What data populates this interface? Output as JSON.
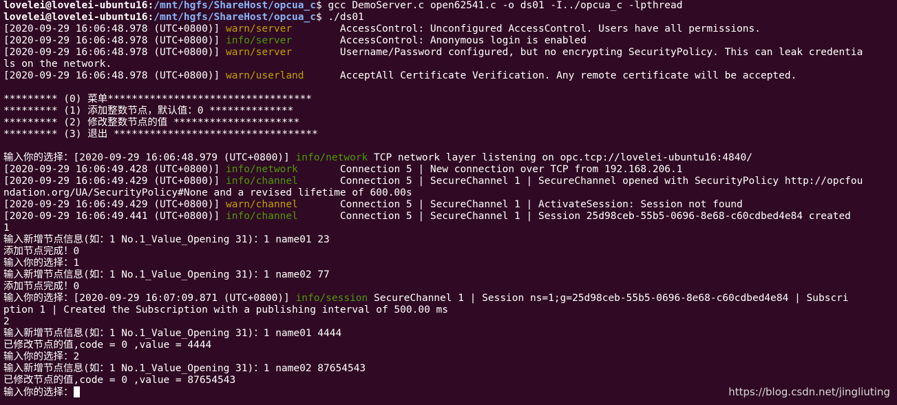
{
  "terminal": {
    "lines": [
      {
        "segments": [
          {
            "t": "lovelei@lovelei-ubuntu16",
            "c": "user"
          },
          {
            "t": ":",
            "c": "user"
          },
          {
            "t": "/mnt/hgfs/ShareHost/opcua_c",
            "c": "path"
          },
          {
            "t": "$ gcc DemoServer.c open62541.c -o ds01 -I../opcua_c -lpthread",
            "c": "plain"
          }
        ]
      },
      {
        "segments": [
          {
            "t": "lovelei@lovelei-ubuntu16",
            "c": "user"
          },
          {
            "t": ":",
            "c": "user"
          },
          {
            "t": "/mnt/hgfs/ShareHost/opcua_c",
            "c": "path"
          },
          {
            "t": "$ ./ds01",
            "c": "plain"
          }
        ]
      },
      {
        "segments": [
          {
            "t": "[2020-09-29 16:06:48.978 (UTC+0800)] ",
            "c": "plain"
          },
          {
            "t": "warn/server",
            "c": "warn"
          },
          {
            "t": "        AccessControl: Unconfigured AccessControl. Users have all permissions.",
            "c": "plain"
          }
        ]
      },
      {
        "segments": [
          {
            "t": "[2020-09-29 16:06:48.978 (UTC+0800)] ",
            "c": "plain"
          },
          {
            "t": "info/server",
            "c": "info"
          },
          {
            "t": "        AccessControl: Anonymous login is enabled",
            "c": "plain"
          }
        ]
      },
      {
        "segments": [
          {
            "t": "[2020-09-29 16:06:48.978 (UTC+0800)] ",
            "c": "plain"
          },
          {
            "t": "warn/server",
            "c": "warn"
          },
          {
            "t": "        Username/Password configured, but no encrypting SecurityPolicy. This can leak credentia",
            "c": "plain"
          }
        ]
      },
      {
        "segments": [
          {
            "t": "ls on the network.",
            "c": "plain"
          }
        ]
      },
      {
        "segments": [
          {
            "t": "[2020-09-29 16:06:48.978 (UTC+0800)] ",
            "c": "plain"
          },
          {
            "t": "warn/userland",
            "c": "warn"
          },
          {
            "t": "      AcceptAll Certificate Verification. Any remote certificate will be accepted.",
            "c": "plain"
          }
        ]
      },
      {
        "segments": [
          {
            "t": "",
            "c": "plain"
          }
        ]
      },
      {
        "segments": [
          {
            "t": "********* (0) 菜单**********************************",
            "c": "plain"
          }
        ]
      },
      {
        "segments": [
          {
            "t": "********* (1) 添加整数节点，默认值：0 **************",
            "c": "plain"
          }
        ]
      },
      {
        "segments": [
          {
            "t": "********* (2) 修改整数节点的值 *********************",
            "c": "plain"
          }
        ]
      },
      {
        "segments": [
          {
            "t": "********* (3) 退出 **********************************",
            "c": "plain"
          }
        ]
      },
      {
        "segments": [
          {
            "t": "",
            "c": "plain"
          }
        ]
      },
      {
        "segments": [
          {
            "t": "输入你的选择：[2020-09-29 16:06:48.979 (UTC+0800)] ",
            "c": "plain"
          },
          {
            "t": "info/network",
            "c": "info"
          },
          {
            "t": " TCP network layer listening on opc.tcp://lovelei-ubuntu16:4840/",
            "c": "plain"
          }
        ]
      },
      {
        "segments": [
          {
            "t": "[2020-09-29 16:06:49.428 (UTC+0800)] ",
            "c": "plain"
          },
          {
            "t": "info/network",
            "c": "info"
          },
          {
            "t": "       Connection 5 | New connection over TCP from 192.168.206.1",
            "c": "plain"
          }
        ]
      },
      {
        "segments": [
          {
            "t": "[2020-09-29 16:06:49.429 (UTC+0800)] ",
            "c": "plain"
          },
          {
            "t": "info/channel",
            "c": "info"
          },
          {
            "t": "       Connection 5 | SecureChannel 1 | SecureChannel opened with SecurityPolicy http://opcfou",
            "c": "plain"
          }
        ]
      },
      {
        "segments": [
          {
            "t": "ndation.org/UA/SecurityPolicy#None and a revised lifetime of 600.00s",
            "c": "plain"
          }
        ]
      },
      {
        "segments": [
          {
            "t": "[2020-09-29 16:06:49.429 (UTC+0800)] ",
            "c": "plain"
          },
          {
            "t": "warn/channel",
            "c": "warn"
          },
          {
            "t": "       Connection 5 | SecureChannel 1 | ActivateSession: Session not found",
            "c": "plain"
          }
        ]
      },
      {
        "segments": [
          {
            "t": "[2020-09-29 16:06:49.441 (UTC+0800)] ",
            "c": "plain"
          },
          {
            "t": "info/channel",
            "c": "info"
          },
          {
            "t": "       Connection 5 | SecureChannel 1 | Session 25d98ceb-55b5-0696-8e68-c60cdbed4e84 created",
            "c": "plain"
          }
        ]
      },
      {
        "segments": [
          {
            "t": "1",
            "c": "plain"
          }
        ]
      },
      {
        "segments": [
          {
            "t": "输入新增节点信息(如：1 No.1_Value_Opening 31)：1 name01 23",
            "c": "plain"
          }
        ]
      },
      {
        "segments": [
          {
            "t": "添加节点完成！0",
            "c": "plain"
          }
        ]
      },
      {
        "segments": [
          {
            "t": "输入你的选择：1",
            "c": "plain"
          }
        ]
      },
      {
        "segments": [
          {
            "t": "输入新增节点信息(如：1 No.1_Value_Opening 31)：1 name02 77",
            "c": "plain"
          }
        ]
      },
      {
        "segments": [
          {
            "t": "添加节点完成！0",
            "c": "plain"
          }
        ]
      },
      {
        "segments": [
          {
            "t": "输入你的选择：[2020-09-29 16:07:09.871 (UTC+0800)] ",
            "c": "plain"
          },
          {
            "t": "info/session",
            "c": "info"
          },
          {
            "t": " SecureChannel 1 | Session ns=1;g=25d98ceb-55b5-0696-8e68-c60cdbed4e84 | Subscri",
            "c": "plain"
          }
        ]
      },
      {
        "segments": [
          {
            "t": "ption 1 | Created the Subscription with a publishing interval of 500.00 ms",
            "c": "plain"
          }
        ]
      },
      {
        "segments": [
          {
            "t": "2",
            "c": "plain"
          }
        ]
      },
      {
        "segments": [
          {
            "t": "输入新增节点信息(如：1 No.1_Value_Opening 31)：1 name01 4444",
            "c": "plain"
          }
        ]
      },
      {
        "segments": [
          {
            "t": "已修改节点的值,code = 0 ,value = 4444",
            "c": "plain"
          }
        ]
      },
      {
        "segments": [
          {
            "t": "输入你的选择：2",
            "c": "plain"
          }
        ]
      },
      {
        "segments": [
          {
            "t": "输入新增节点信息(如：1 No.1_Value_Opening 31)：1 name02 87654543",
            "c": "plain"
          }
        ]
      },
      {
        "segments": [
          {
            "t": "已修改节点的值,code = 0 ,value = 87654543",
            "c": "plain"
          }
        ]
      },
      {
        "segments": [
          {
            "t": "输入你的选择：",
            "c": "plain"
          }
        ]
      }
    ]
  },
  "watermark": "https://blog.csdn.net/jingliuting",
  "colors": {
    "background": "#300a24",
    "text": "#ffffff",
    "path": "#8ab4f8",
    "warn": "#c4a000",
    "info": "#4e9a06"
  }
}
